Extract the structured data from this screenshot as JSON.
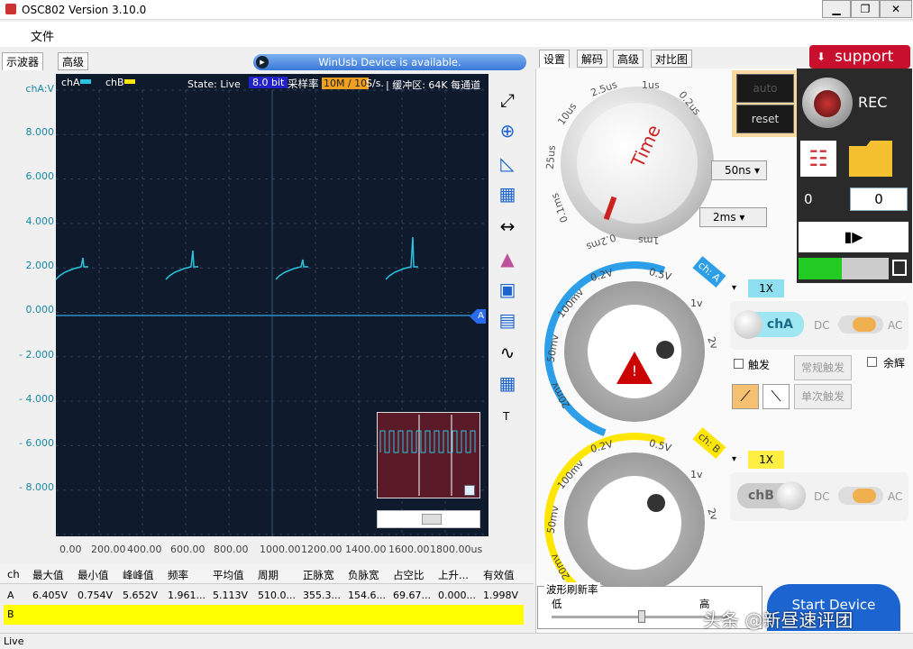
{
  "window": {
    "title": "OSC802  Version 3.10.0",
    "min": "▁",
    "max": "❐",
    "close": "✕"
  },
  "menu": {
    "file": "文件"
  },
  "left_tabs": [
    "示波器",
    "高级"
  ],
  "banner": {
    "text": "WinUsb Device  is available."
  },
  "scope": {
    "ch_a": "chA",
    "ch_b": "chB",
    "state": "State: Live",
    "bits": "8.0 bit",
    "rate_label": "采样率",
    "rate_value": "10M / 10",
    "rate_unit": "S/s.",
    "buffer": "| 缓冲区: 64K 每通道",
    "y_unit": "chA:V",
    "y_ticks": [
      "8.000",
      "6.000",
      "4.000",
      "2.000",
      "0.000",
      "- 2.000",
      "- 4.000",
      "- 6.000",
      "- 8.000"
    ],
    "x_ticks": [
      "0.00",
      "200.00",
      "400.00",
      "600.00",
      "800.00",
      "1000.00",
      "1200.00",
      "1400.00",
      "1600.00",
      "1800.00us"
    ],
    "marker": "A",
    "t_label": "T"
  },
  "measure": {
    "headers": [
      "ch",
      "最大值",
      "最小值",
      "峰峰值",
      "频率",
      "平均值",
      "周期",
      "正脉宽",
      "负脉宽",
      "占空比",
      "上升...",
      "有效值"
    ],
    "row_a": [
      "A",
      "6.405V",
      "0.754V",
      "5.652V",
      "1.961...",
      "5.113V",
      "510.0...",
      "355.3...",
      "154.6...",
      "69.67...",
      "0.000...",
      "1.998V"
    ],
    "row_b": "B"
  },
  "status": "Live",
  "right_tabs": [
    "设置",
    "解码",
    "高级",
    "对比图"
  ],
  "support": "support",
  "time": {
    "label": "Time",
    "ticks": [
      "2.5us",
      "1us",
      "0.2us",
      "10us",
      "25us",
      "0.1ms",
      "0.2ms",
      "1ms"
    ],
    "sel1": "50ns",
    "sel2": "2ms",
    "auto": "auto",
    "reset": "reset"
  },
  "rec": {
    "label": "REC",
    "counter_a": "0",
    "counter_b": "0"
  },
  "cha": {
    "badge": "ch: A",
    "ticks": [
      "0.2V",
      "0.5V",
      "1v",
      "2v",
      "100mv",
      "50mv",
      "20mv"
    ],
    "probe": "1X",
    "toggle": "chA",
    "dc": "DC",
    "ac": "AC"
  },
  "chb": {
    "badge": "ch: B",
    "ticks": [
      "0.2V",
      "0.5V",
      "1v",
      "2v",
      "100mv",
      "50mv",
      "20mv"
    ],
    "probe": "1X",
    "toggle": "chB",
    "dc": "DC",
    "ac": "AC"
  },
  "trigger": {
    "label": "触发",
    "normal": "常规触发",
    "single": "单次触发",
    "afterglow": "余辉"
  },
  "refresh": {
    "label": "波形刷新率",
    "low": "低",
    "high": "高"
  },
  "start": "Start Device",
  "watermark": "头条 @新昼速评团",
  "colors": {
    "cha": "#2bc4e0",
    "chb": "#ffe600",
    "accent": "#1c64d0",
    "support": "#c8102e"
  }
}
